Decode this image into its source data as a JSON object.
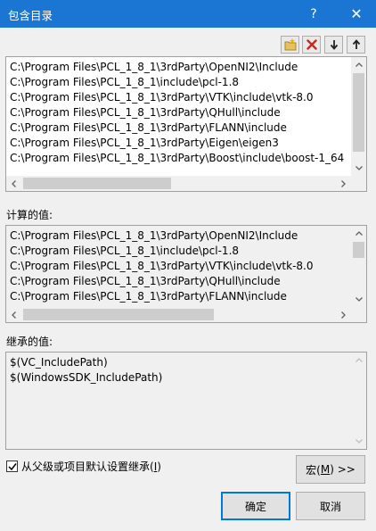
{
  "window": {
    "title": "包含目录",
    "help_label": "?",
    "close_label": "✕"
  },
  "toolbar": {
    "icons": [
      "new-line-icon",
      "delete-icon",
      "move-down-icon",
      "move-up-icon"
    ]
  },
  "edit_list": {
    "lines": [
      "C:\\Program Files\\PCL_1_8_1\\3rdParty\\OpenNI2\\Include",
      "C:\\Program Files\\PCL_1_8_1\\include\\pcl-1.8",
      "C:\\Program Files\\PCL_1_8_1\\3rdParty\\VTK\\include\\vtk-8.0",
      "C:\\Program Files\\PCL_1_8_1\\3rdParty\\QHull\\include",
      "C:\\Program Files\\PCL_1_8_1\\3rdParty\\FLANN\\include",
      "C:\\Program Files\\PCL_1_8_1\\3rdParty\\Eigen\\eigen3",
      "C:\\Program Files\\PCL_1_8_1\\3rdParty\\Boost\\include\\boost-1_64"
    ]
  },
  "evaluated": {
    "label": "计算的值:",
    "lines": [
      "C:\\Program Files\\PCL_1_8_1\\3rdParty\\OpenNI2\\Include",
      "C:\\Program Files\\PCL_1_8_1\\include\\pcl-1.8",
      "C:\\Program Files\\PCL_1_8_1\\3rdParty\\VTK\\include\\vtk-8.0",
      "C:\\Program Files\\PCL_1_8_1\\3rdParty\\QHull\\include",
      "C:\\Program Files\\PCL_1_8_1\\3rdParty\\FLANN\\include"
    ]
  },
  "inherited": {
    "label": "继承的值:",
    "lines": [
      "$(VC_IncludePath)",
      "$(WindowsSDK_IncludePath)"
    ]
  },
  "inherit_checkbox": {
    "label_text": "从父级或项目默认设置继承(",
    "accel": "I",
    "label_close": ")",
    "checked": true
  },
  "buttons": {
    "macros_text": "宏(",
    "macros_accel": "M",
    "macros_close": ") >>",
    "ok": "确定",
    "cancel": "取消"
  }
}
